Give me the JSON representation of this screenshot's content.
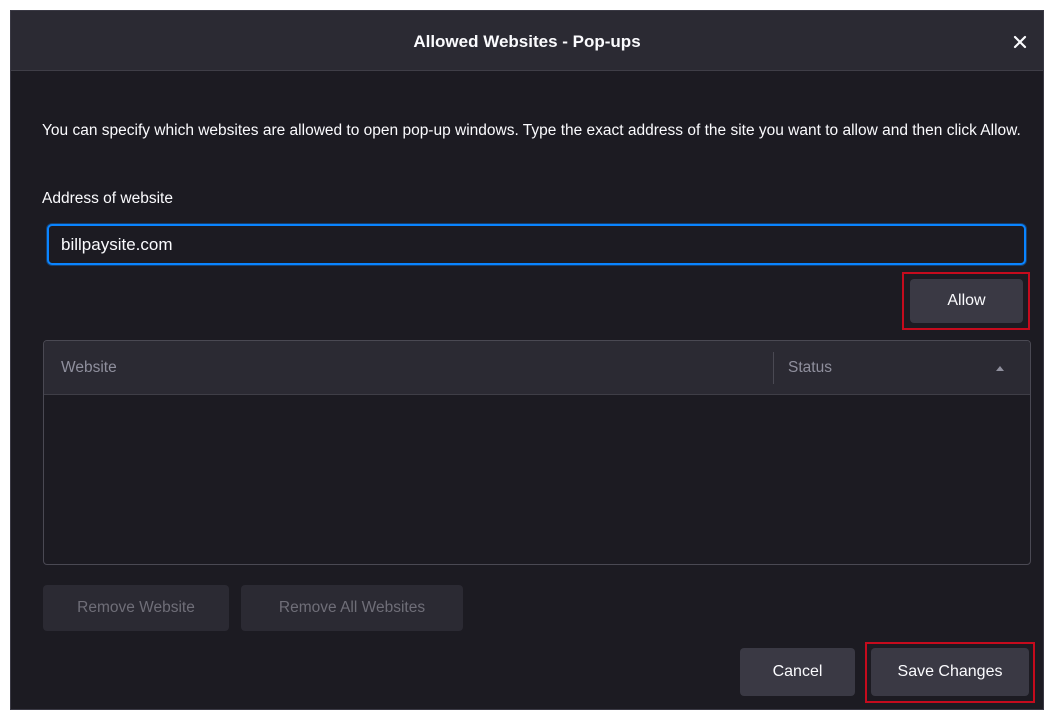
{
  "dialog": {
    "title": "Allowed Websites - Pop-ups",
    "close_icon": "close-icon"
  },
  "description": "You can specify which websites are allowed to open pop-up windows. Type the exact address of the site you want to allow and then click Allow.",
  "address_field": {
    "label": "Address of website",
    "value": "billpaysite.com"
  },
  "buttons": {
    "allow": "Allow",
    "remove_website": "Remove Website",
    "remove_all": "Remove All Websites",
    "cancel": "Cancel",
    "save_changes": "Save Changes"
  },
  "table": {
    "columns": [
      "Website",
      "Status"
    ],
    "sort_icon": "sort-ascending-icon",
    "rows": []
  },
  "colors": {
    "background": "#1c1b22",
    "header": "#2b2a33",
    "button": "#3a3944",
    "focus_accent": "#0a84ff",
    "highlight": "#c50b1d"
  }
}
